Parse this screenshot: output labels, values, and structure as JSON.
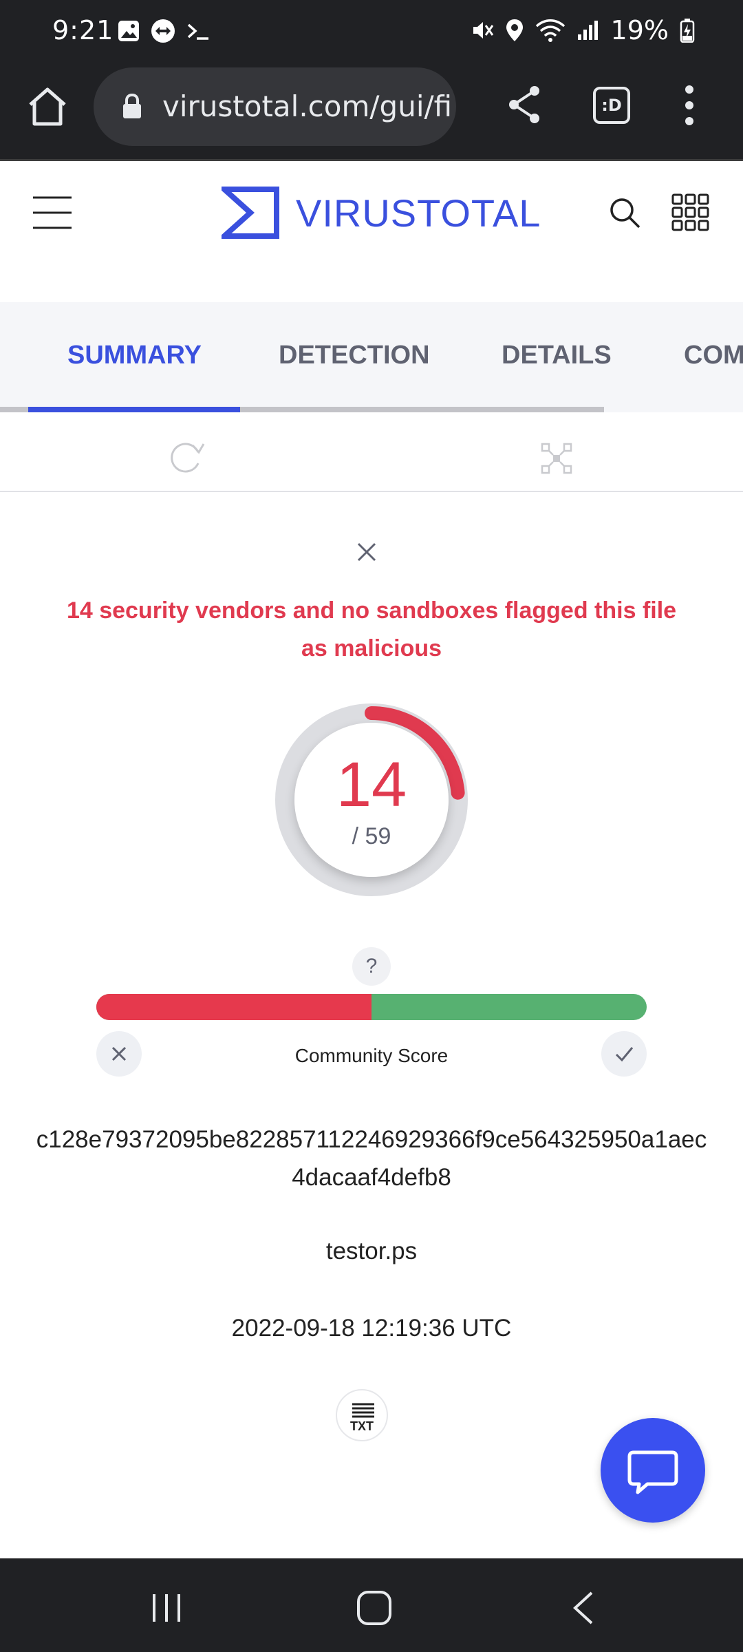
{
  "status_bar": {
    "time": "9:21",
    "battery": "19%"
  },
  "browser": {
    "url": "virustotal.com/gui/file",
    "tab_icon_label": ":D"
  },
  "header": {
    "logo_text": "VIRUSTOTAL"
  },
  "tabs": [
    {
      "label": "SUMMARY",
      "active": true
    },
    {
      "label": "DETECTION",
      "active": false
    },
    {
      "label": "DETAILS",
      "active": false
    },
    {
      "label": "COMMUNITY",
      "active": false
    }
  ],
  "alert": {
    "message": "14 security vendors and no sandboxes flagged this file as malicious"
  },
  "detection": {
    "malicious": "14",
    "total": "/ 59",
    "ratio": 0.237
  },
  "community": {
    "help": "?",
    "label": "Community Score",
    "negative_fraction": 0.5
  },
  "file": {
    "hash": "c128e79372095be822857112246929366f9ce564325950a1aec4dacaaf4defb8",
    "name": "testor.ps",
    "date": "2022-09-18 12:19:36 UTC",
    "type_label": "TXT"
  },
  "colors": {
    "brand": "#3a50de",
    "malicious": "#e03a4f",
    "harmless": "#57b171"
  }
}
